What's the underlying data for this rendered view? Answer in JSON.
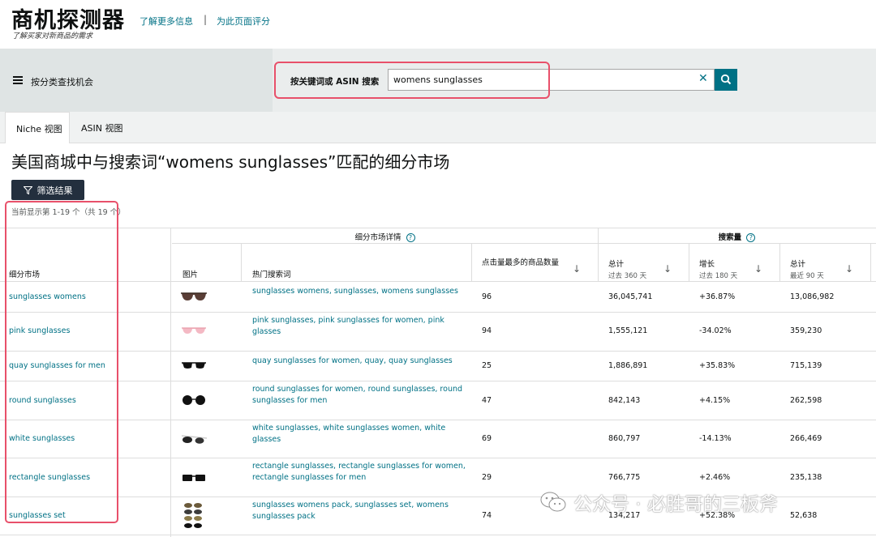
{
  "header": {
    "title": "商机探测器",
    "subtitle": "了解买家对新商品的需求",
    "learn_more": "了解更多信息",
    "separator": "|",
    "rate_page": "为此页面评分"
  },
  "category": {
    "label": "按分类查找机会"
  },
  "search": {
    "label": "按关键词或 ASIN 搜索",
    "value": "womens sunglasses",
    "clear": "✕"
  },
  "tabs": [
    {
      "label": "Niche 视图",
      "active": true
    },
    {
      "label": "ASIN 视图",
      "active": false
    }
  ],
  "page_title": "美国商城中与搜索词“womens sunglasses”匹配的细分市场",
  "filter_button": "筛选结果",
  "result_count": "当前显示第 1-19 个（共 19 个）",
  "table": {
    "group_headers": {
      "details": "细分市场详情",
      "search_volume": "搜索量"
    },
    "headers": {
      "niche": "细分市场",
      "image": "图片",
      "top_terms": "热门搜索词",
      "top_clicked": "点击量最多的商品数量",
      "total": "总计",
      "total_sub": "过去 360 天",
      "growth": "增长",
      "growth_sub": "过去 180 天",
      "total90": "总计",
      "total90_sub": "最近 90 天"
    },
    "rows": [
      {
        "niche": "sunglasses womens",
        "terms_line1": "sunglasses womens, sunglasses, womens sunglasses",
        "terms_line2": "",
        "clicked": "96",
        "total": "36,045,741",
        "growth": "+36.87%",
        "total90": "13,086,982"
      },
      {
        "niche": "pink sunglasses",
        "terms_line1": "pink sunglasses, pink sunglasses for women, pink",
        "terms_line2": "glasses",
        "clicked": "94",
        "total": "1,555,121",
        "growth": "-34.02%",
        "total90": "359,230"
      },
      {
        "niche": "quay sunglasses for men",
        "terms_line1": "quay sunglasses for women, quay, quay sunglasses",
        "terms_line2": "",
        "clicked": "25",
        "total": "1,886,891",
        "growth": "+35.83%",
        "total90": "715,139"
      },
      {
        "niche": "round sunglasses",
        "terms_line1": "round sunglasses for women, round sunglasses, round",
        "terms_line2": "sunglasses for men",
        "clicked": "47",
        "total": "842,143",
        "growth": "+4.15%",
        "total90": "262,598"
      },
      {
        "niche": "white sunglasses",
        "terms_line1": "white sunglasses, white sunglasses women, white",
        "terms_line2": "glasses",
        "clicked": "69",
        "total": "860,797",
        "growth": "-14.13%",
        "total90": "266,469"
      },
      {
        "niche": "rectangle sunglasses",
        "terms_line1": "rectangle sunglasses, rectangle sunglasses for women,",
        "terms_line2": "rectangle sunglasses for men",
        "clicked": "29",
        "total": "766,775",
        "growth": "+2.46%",
        "total90": "235,138"
      },
      {
        "niche": "sunglasses set",
        "terms_line1": "sunglasses womens pack, sunglasses set, womens",
        "terms_line2": "sunglasses pack",
        "clicked": "74",
        "total": "134,217",
        "growth": "+52.38%",
        "total90": "52,638"
      }
    ]
  },
  "watermark": "公众号 · 必胜哥的三板斧",
  "colors": {
    "accent": "#007185",
    "highlight": "#e8506a",
    "dark_button": "#232f3e"
  }
}
